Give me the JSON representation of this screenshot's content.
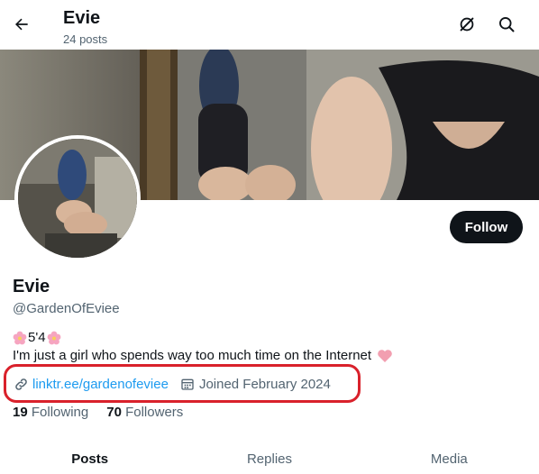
{
  "header": {
    "name": "Evie",
    "posts_count": "24 posts"
  },
  "profile": {
    "display_name": "Evie",
    "handle": "@GardenOfEviee",
    "bio_line1": "5'4",
    "bio_line2": "I'm just a girl who spends way too much time on the Internet",
    "link_text": "linktr.ee/gardenofeviee",
    "joined_text": "Joined February 2024",
    "following_count": "19",
    "following_label": "Following",
    "followers_count": "70",
    "followers_label": "Followers"
  },
  "actions": {
    "follow_label": "Follow"
  },
  "tabs": [
    {
      "label": "Posts"
    },
    {
      "label": "Replies"
    },
    {
      "label": "Media"
    }
  ],
  "colors": {
    "accent_link": "#1d9bf0",
    "highlight_border": "#d9212b",
    "primary_text": "#0f1419",
    "secondary_text": "#536471"
  },
  "icons": {
    "back": "arrow-left-icon",
    "grok": "grok-icon",
    "search": "search-icon",
    "link": "link-icon",
    "calendar": "calendar-icon",
    "flower": "cherry-blossom-icon",
    "heart": "pink-heart-icon"
  }
}
